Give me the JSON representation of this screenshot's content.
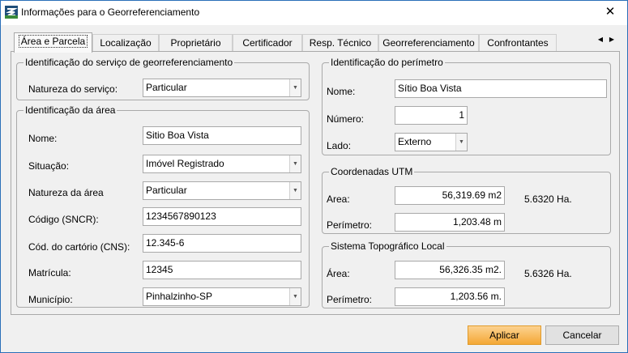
{
  "window": {
    "title": "Informações para o Georreferenciamento",
    "close_glyph": "✕",
    "app_icon": "app-logo-icon"
  },
  "tabs": [
    {
      "label": "Área e Parcela",
      "active": true
    },
    {
      "label": "Localização",
      "active": false
    },
    {
      "label": "Proprietário",
      "active": false
    },
    {
      "label": "Certificador",
      "active": false
    },
    {
      "label": "Resp. Técnico",
      "active": false
    },
    {
      "label": "Georreferenciamento",
      "active": false
    },
    {
      "label": "Confrontantes",
      "active": false
    }
  ],
  "tab_scroll": {
    "left": "◀",
    "right": "▶"
  },
  "servico": {
    "legend": "Identificação do serviço de georreferenciamento",
    "natureza_label": "Natureza do serviço:",
    "natureza_value": "Particular"
  },
  "area": {
    "legend": "Identificação da área",
    "nome_label": "Nome:",
    "nome_value": "Sitio Boa Vista",
    "situacao_label": "Situação:",
    "situacao_value": "Imóvel Registrado",
    "natureza_label": "Natureza da área",
    "natureza_value": "Particular",
    "codigo_label": "Código (SNCR):",
    "codigo_value": "1234567890123",
    "cns_label": "Cód. do cartório (CNS):",
    "cns_value": "12.345-6",
    "matricula_label": "Matrícula:",
    "matricula_value": "12345",
    "municipio_label": "Município:",
    "municipio_value": "Pinhalzinho-SP"
  },
  "perimetro": {
    "legend": "Identificação do perímetro",
    "nome_label": "Nome:",
    "nome_value": "Sítio Boa Vista",
    "numero_label": "Número:",
    "numero_value": "1",
    "lado_label": "Lado:",
    "lado_value": "Externo"
  },
  "utm": {
    "legend": "Coordenadas UTM",
    "area_label": "Area:",
    "area_value": "56,319.69 m2",
    "area_ha": "5.6320 Ha.",
    "perimetro_label": "Perímetro:",
    "perimetro_value": "1,203.48 m"
  },
  "stl": {
    "legend": "Sistema Topográfico Local",
    "area_label": "Área:",
    "area_value": "56,326.35 m2.",
    "area_ha": "5.6326 Ha.",
    "perimetro_label": "Perímetro:",
    "perimetro_value": "1,203.56 m."
  },
  "buttons": {
    "apply": "Aplicar",
    "cancel": "Cancelar"
  },
  "combo_arrow": "▼",
  "colors": {
    "accent": "#f4a836",
    "title_border": "#2a6fb8"
  }
}
